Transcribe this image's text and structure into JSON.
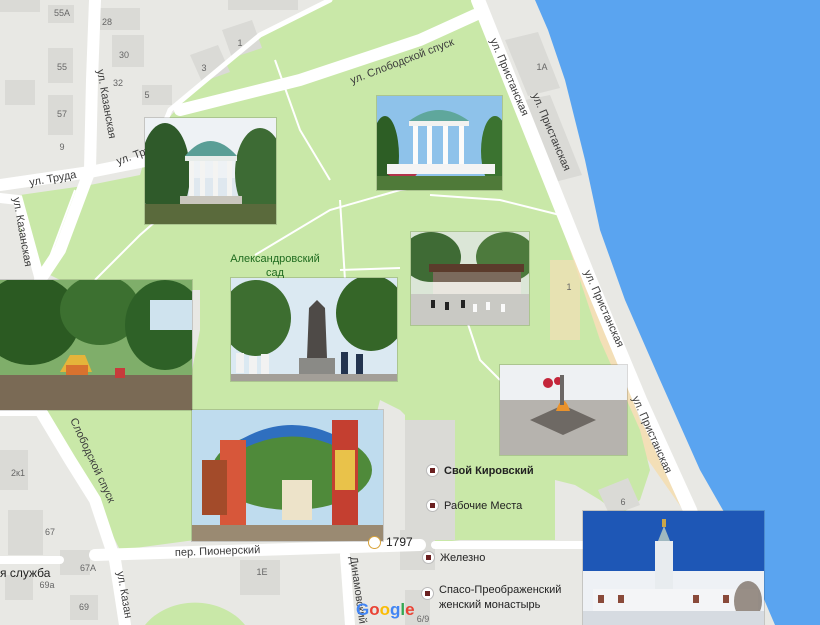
{
  "map": {
    "park_name": "Александровский сад",
    "streets": {
      "slobodskoy_spusk_top": "ул. Слободской спуск",
      "pristanskaya_1": "ул. Пристанская",
      "pristanskaya_2": "ул. Пристанская",
      "pristanskaya_3": "ул. Пристанская",
      "pristanskaya_4": "ул. Пристанская",
      "kazanskaya_1": "ул. Казанская",
      "kazanskaya_2": "ул. Казанская",
      "kazanskaya_3": "ул. Казан",
      "truda_1": "ул. Труда",
      "truda_2": "ул. Труда",
      "slobodskoy_spusk_left": "Слободской спуск",
      "pionerskiy": "пер. Пионерский",
      "dinamovskiy": "Динамовский"
    },
    "building_numbers": [
      "55А",
      "28",
      "30",
      "32",
      "1",
      "3",
      "55",
      "5",
      "57",
      "9",
      "1А",
      "1",
      "2к1",
      "67",
      "67А",
      "69а",
      "69",
      "1Е",
      "6",
      "6/9"
    ],
    "partial_label": "я служба",
    "rating_value": "1797"
  },
  "pois": [
    {
      "label": "Свой Кировский",
      "bold": true
    },
    {
      "label": "Рабочие Места",
      "bold": false
    },
    {
      "label": "Железно",
      "bold": false
    },
    {
      "label": "Спасо-Преображенский женский монастырь",
      "bold": false
    }
  ],
  "logo": {
    "letters": [
      "G",
      "o",
      "o",
      "g",
      "l",
      "e"
    ],
    "colors": [
      "#4285F4",
      "#EA4335",
      "#FBBC05",
      "#4285F4",
      "#34A853",
      "#EA4335"
    ]
  },
  "colors": {
    "water": "#5aa4f0",
    "park": "#c9e8a8",
    "road": "#ffffff",
    "land": "#e8e8e4",
    "building": "#dadad6",
    "sand": "#f3dfb7"
  },
  "photos": [
    {
      "name": "rotunda-photo"
    },
    {
      "name": "gazebo-photo"
    },
    {
      "name": "chess-pavilion-photo"
    },
    {
      "name": "playground-photo"
    },
    {
      "name": "monument-photo"
    },
    {
      "name": "eternal-flame-photo"
    },
    {
      "name": "fair-gate-photo"
    },
    {
      "name": "monastery-photo"
    }
  ]
}
